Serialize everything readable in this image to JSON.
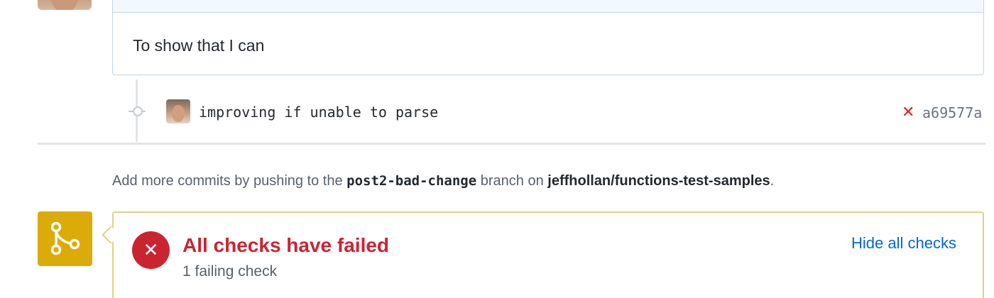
{
  "comment": {
    "body": "To show that I can"
  },
  "commit": {
    "message": "improving if unable to parse",
    "status_icon": "x-icon",
    "status_glyph": "✕",
    "sha": "a69577a"
  },
  "push_hint": {
    "prefix": "Add more commits by pushing to the ",
    "branch": "post2-bad-change",
    "middle": " branch on ",
    "repo": "jeffhollan/functions-test-samples",
    "suffix": "."
  },
  "checks": {
    "icon": "merge-icon",
    "status_icon": "x-circle-icon",
    "status_glyph": "✕",
    "title": "All checks have failed",
    "subtitle": "1 failing check",
    "toggle_label": "Hide all checks"
  },
  "colors": {
    "fail_red": "#cb2431",
    "link_blue": "#0366d6",
    "warning_yellow": "#dbab09"
  }
}
